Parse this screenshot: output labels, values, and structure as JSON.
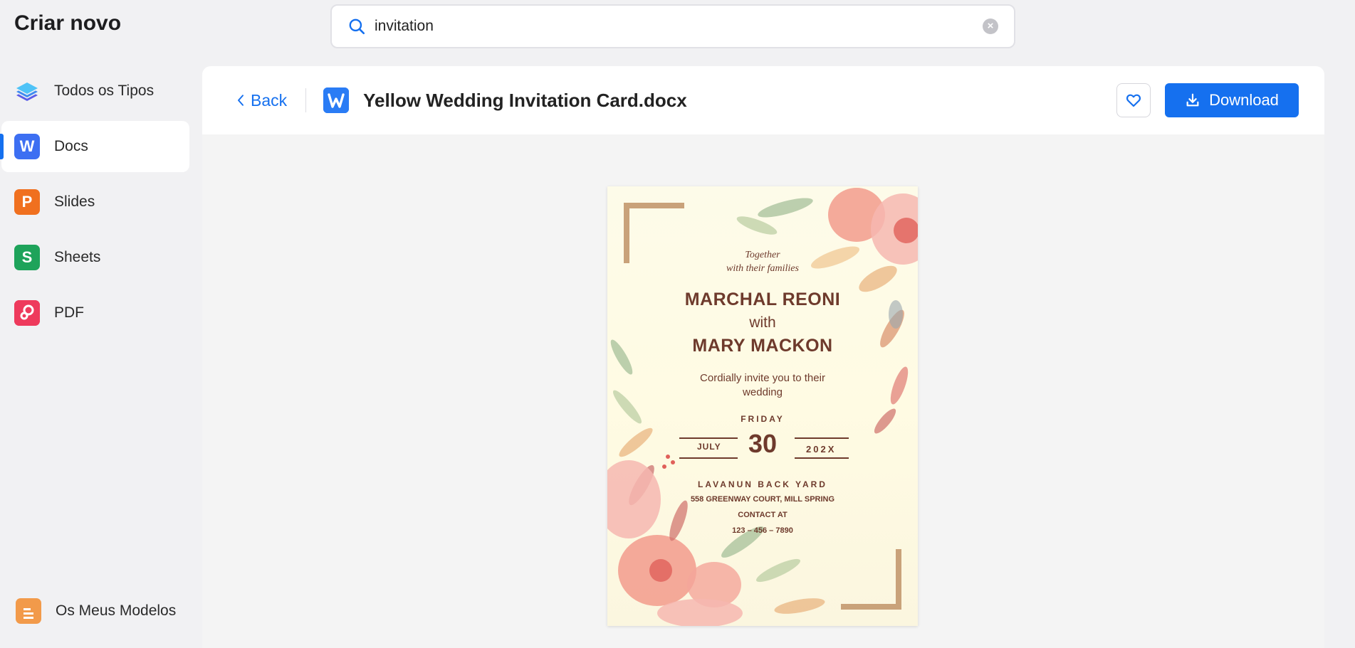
{
  "app": {
    "title": "Criar novo"
  },
  "search": {
    "value": "invitation",
    "clear_icon": "close-circle-icon"
  },
  "sidebar": {
    "items": [
      {
        "label": "Todos os Tipos",
        "icon": "layers-icon"
      },
      {
        "label": "Docs",
        "icon": "W",
        "active": true
      },
      {
        "label": "Slides",
        "icon": "P"
      },
      {
        "label": "Sheets",
        "icon": "S"
      },
      {
        "label": "PDF",
        "icon": "pdf-icon"
      }
    ],
    "bottom": {
      "label": "Os Meus Modelos",
      "icon": "my-templates-icon"
    }
  },
  "header": {
    "back_label": "Back",
    "file_title": "Yellow Wedding Invitation Card.docx",
    "download_label": "Download"
  },
  "card": {
    "line1": "Together",
    "line2": "with their families",
    "name1": "MARCHAL REONI",
    "with": "with",
    "name2": "MARY MACKON",
    "invite1": "Cordially invite you to their",
    "invite2": "wedding",
    "weekday": "FRIDAY",
    "day": "30",
    "month": "JULY",
    "year": "202X",
    "venue": "LAVANUN BACK YARD",
    "address": "558  GREENWAY  COURT, MILL SPRING",
    "contact": "CONTACT AT",
    "phone": "123 – 456 – 7890"
  },
  "colors": {
    "accent": "#1570ef",
    "card_text": "#6e3a2c"
  }
}
